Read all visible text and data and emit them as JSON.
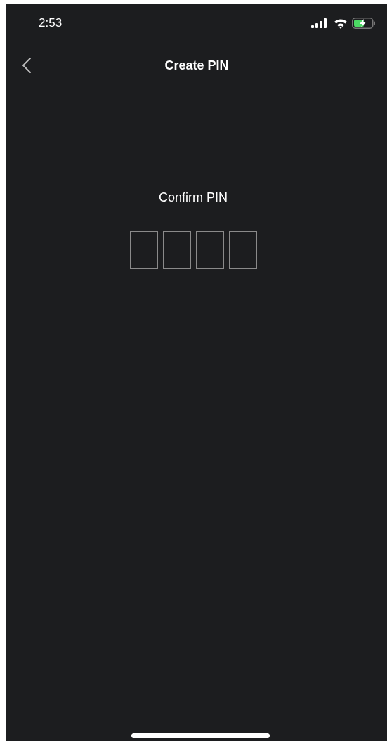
{
  "status_bar": {
    "time": "2:53"
  },
  "nav": {
    "title": "Create PIN"
  },
  "pin": {
    "label": "Confirm PIN",
    "boxes": [
      {
        "filled": false
      },
      {
        "filled": false
      },
      {
        "filled": false
      },
      {
        "filled": false
      }
    ]
  }
}
